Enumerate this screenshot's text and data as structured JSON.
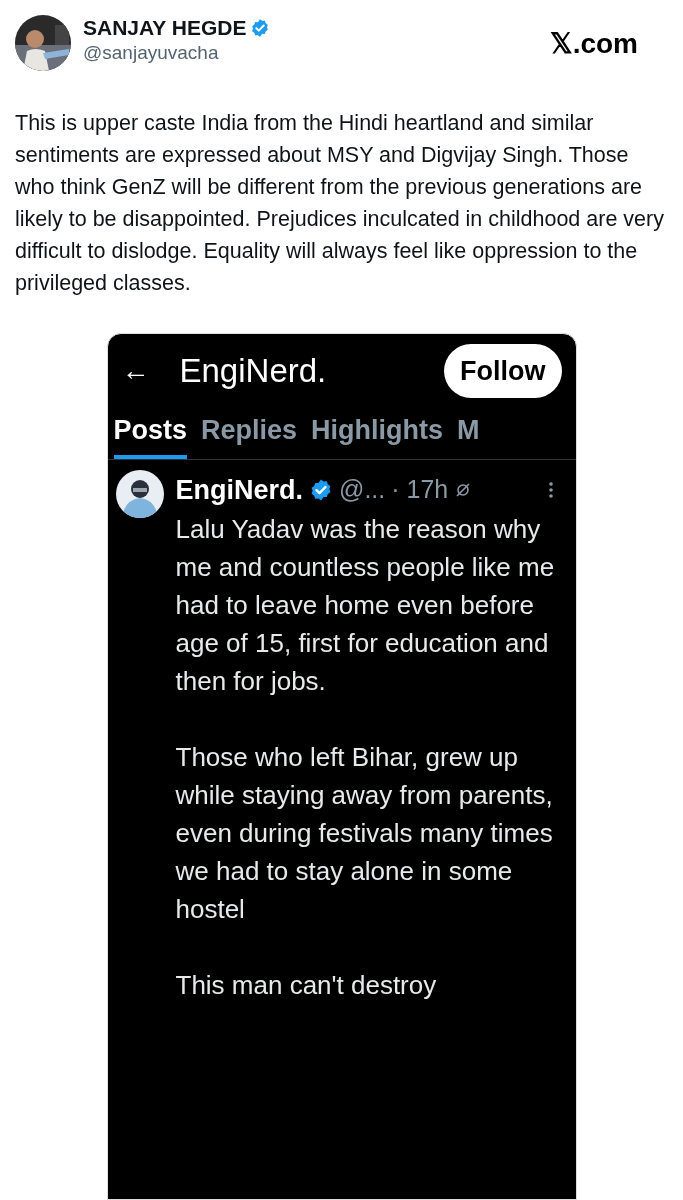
{
  "author": {
    "name": "SANJAY HEGDE",
    "verified": true,
    "handle": "@sanjayuvacha"
  },
  "site": "𝕏.com",
  "tweet_text": "This is upper caste India from the Hindi heartland  and similar sentiments are expressed about MSY and Digvijay Singh. Those who think GenZ will be different from the previous generations are likely to be disappointed. Prejudices inculcated in childhood are very difficult to dislodge. Equality will always feel like oppression to the privileged classes.",
  "screenshot": {
    "back": "←",
    "profile_name": "EngiNerd.",
    "follow": "Follow",
    "tabs": [
      {
        "label": "Posts",
        "selected": true
      },
      {
        "label": "Replies",
        "selected": false
      },
      {
        "label": "Highlights",
        "selected": false
      },
      {
        "label": "M",
        "selected": false
      }
    ],
    "post": {
      "name": "EngiNerd.",
      "verified": true,
      "handle": "@...",
      "time": "· 17h",
      "paragraphs": [
        "Lalu Yadav was the reason why me and countless people like me had to leave home even before age of 15, first for education and then for jobs.",
        "Those who left Bihar, grew up while staying away from parents, even during festivals many times we had to stay alone in some hostel",
        "This man can't destroy"
      ]
    }
  }
}
